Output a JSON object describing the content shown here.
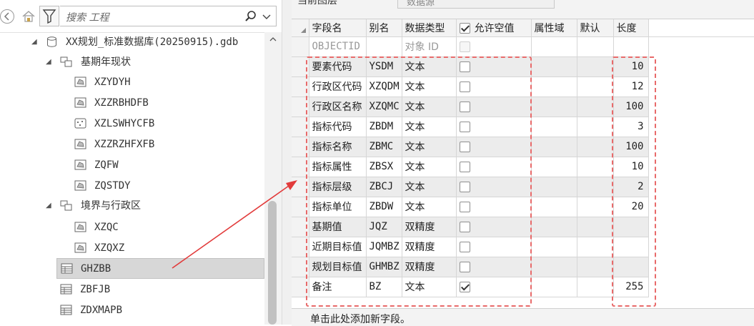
{
  "search": {
    "placeholder": "搜索 工程"
  },
  "tree": {
    "database": "XX规划_标准数据库(20250915).gdb",
    "groups": [
      {
        "label": "基期年现状",
        "items": [
          "XZYDYH",
          "XZZRBHDFB",
          "XZLSWHYCFB",
          "XZZRZHFXFB",
          "ZQFW",
          "ZQSTDY"
        ]
      },
      {
        "label": "境界与行政区",
        "items": [
          "XZQC",
          "XZQXZ"
        ]
      }
    ],
    "tables": [
      "GHZBB",
      "ZBFJB",
      "ZDXMAPB"
    ],
    "selected": "GHZBB"
  },
  "top": {
    "caption": "当前图层",
    "value": "数据源"
  },
  "grid": {
    "headers": {
      "field": "字段名",
      "alias": "别名",
      "type": "数据类型",
      "nullable": "允许空值",
      "domain": "属性域",
      "default": "默认",
      "length": "长度"
    },
    "rows": [
      {
        "field": "OBJECTID",
        "alias": "",
        "type": "对象 ID",
        "nullable": false,
        "length": ""
      },
      {
        "field": "要素代码",
        "alias": "YSDM",
        "type": "文本",
        "nullable": false,
        "length": "10"
      },
      {
        "field": "行政区代码",
        "alias": "XZQDM",
        "type": "文本",
        "nullable": false,
        "length": "12"
      },
      {
        "field": "行政区名称",
        "alias": "XZQMC",
        "type": "文本",
        "nullable": false,
        "length": "100"
      },
      {
        "field": "指标代码",
        "alias": "ZBDM",
        "type": "文本",
        "nullable": false,
        "length": "3"
      },
      {
        "field": "指标名称",
        "alias": "ZBMC",
        "type": "文本",
        "nullable": false,
        "length": "100"
      },
      {
        "field": "指标属性",
        "alias": "ZBSX",
        "type": "文本",
        "nullable": false,
        "length": "10"
      },
      {
        "field": "指标层级",
        "alias": "ZBCJ",
        "type": "文本",
        "nullable": false,
        "length": "2"
      },
      {
        "field": "指标单位",
        "alias": "ZBDW",
        "type": "文本",
        "nullable": false,
        "length": "20"
      },
      {
        "field": "基期值",
        "alias": "JQZ",
        "type": "双精度",
        "nullable": false,
        "length": ""
      },
      {
        "field": "近期目标值",
        "alias": "JQMBZ",
        "type": "双精度",
        "nullable": false,
        "length": ""
      },
      {
        "field": "规划目标值",
        "alias": "GHMBZ",
        "type": "双精度",
        "nullable": false,
        "length": ""
      },
      {
        "field": "备注",
        "alias": "BZ",
        "type": "文本",
        "nullable": true,
        "length": "255"
      }
    ],
    "add_field": "单击此处添加新字段。"
  },
  "colors": {
    "annotation": "#e86a6a",
    "arrow": "#e23b3b",
    "selection": "#d7d7d7"
  }
}
